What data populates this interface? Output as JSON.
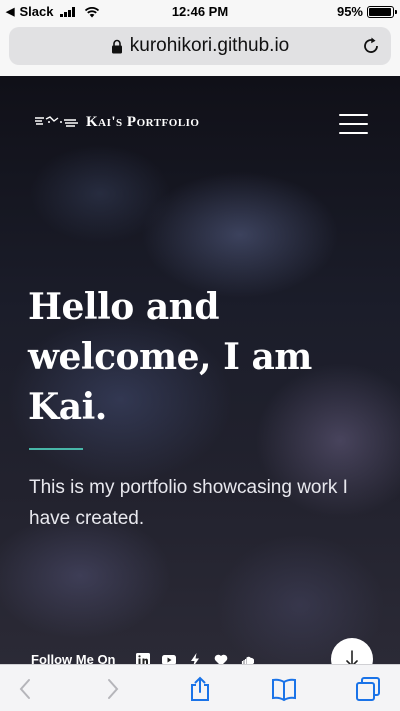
{
  "status_bar": {
    "back_app": "Slack",
    "time": "12:46 PM",
    "battery_percent": "95%",
    "battery_level": 0.95
  },
  "browser": {
    "url": "kurohikori.github.io"
  },
  "site": {
    "logo_text": "Kai's Portfolio",
    "heading": "Hello and welcome, I am Kai.",
    "subtext": "This is my portfolio showcasing work I have created.",
    "follow_label": "Follow Me On",
    "social_icons": [
      "linkedin-icon",
      "youtube-icon",
      "lightning-icon",
      "heart-icon",
      "soundcloud-icon"
    ],
    "accent_color": "#48b6a8"
  },
  "toolbar": {
    "icons": [
      "back-arrow-icon",
      "forward-arrow-icon",
      "share-icon",
      "bookmarks-icon",
      "tabs-icon"
    ],
    "tint_color": "#1a73e8"
  }
}
